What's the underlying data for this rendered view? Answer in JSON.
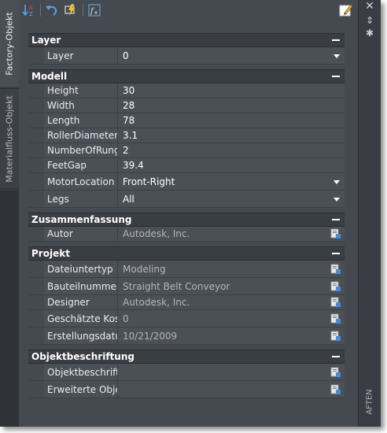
{
  "left_tabs": {
    "factory_object": "Factory-Objekt",
    "material_flow_object": "Materialfluss-Objekt"
  },
  "right_strip": {
    "close": "✕",
    "pin": "⇕",
    "settings": "✱",
    "bottom_label": "AFTEN"
  },
  "toolbar": {
    "icons": [
      "sort-icon",
      "undo-icon",
      "quick-select-icon",
      "function-icon",
      "edit-icon"
    ]
  },
  "palette": {
    "layer": {
      "title": "Layer",
      "rows": [
        {
          "name": "Layer",
          "value": "0"
        }
      ]
    },
    "modell": {
      "title": "Modell",
      "rows": [
        {
          "name": "Height",
          "value": "30"
        },
        {
          "name": "Width",
          "value": "28"
        },
        {
          "name": "Length",
          "value": "78"
        },
        {
          "name": "RollerDiameter",
          "value": "3.1"
        },
        {
          "name": "NumberOfRungs",
          "value": "2"
        },
        {
          "name": "FeetGap",
          "value": "39.4"
        },
        {
          "name": "MotorLocation",
          "value": "Front-Right"
        },
        {
          "name": "Legs",
          "value": "All"
        }
      ]
    },
    "zusammenfassung": {
      "title": "Zusammenfassung",
      "rows": [
        {
          "name": "Autor",
          "value": "Autodesk, Inc."
        }
      ]
    },
    "projekt": {
      "title": "Projekt",
      "rows": [
        {
          "name": "Dateiuntertyp",
          "value": "Modeling"
        },
        {
          "name": "Bauteilnummer",
          "value": "Straight Belt Conveyor"
        },
        {
          "name": "Designer",
          "value": "Autodesk, Inc."
        },
        {
          "name": "Geschätzte Koste",
          "value": "0"
        },
        {
          "name": "Erstellungsdatum",
          "value": "10/21/2009"
        }
      ]
    },
    "objektbeschriftung": {
      "title": "Objektbeschriftung",
      "rows": [
        {
          "name": "Objektbeschriftu",
          "value": ""
        },
        {
          "name": "Erweiterte Objekt",
          "value": ""
        }
      ]
    }
  },
  "colors": {
    "panel_bg": "#454a51",
    "header_bg": "#3a3d42",
    "row_bg": "#4b5057",
    "text": "#ffffff"
  }
}
